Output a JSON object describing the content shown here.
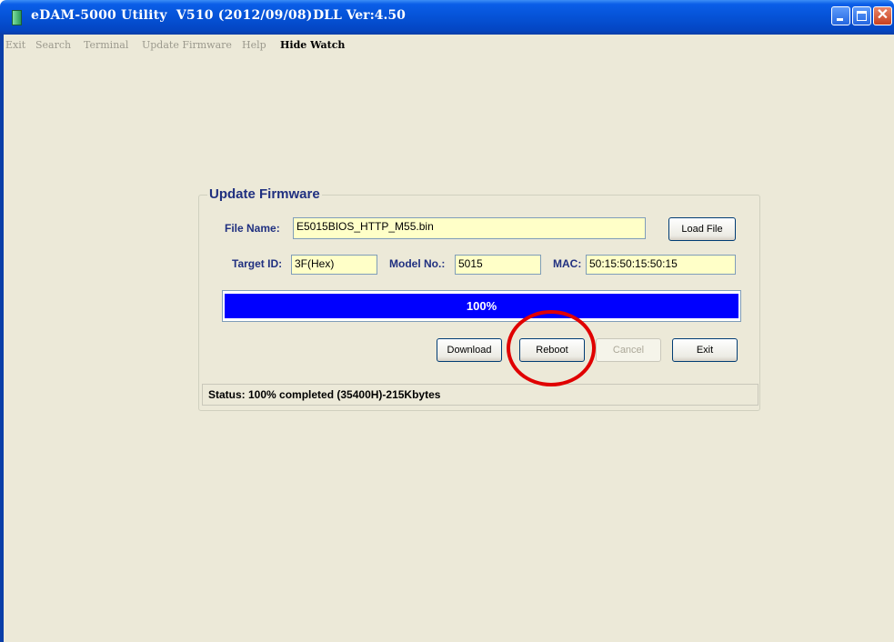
{
  "window": {
    "title": "eDAM-5000 Utility  V510 (2012/09/08)",
    "dll_version": "DLL Ver:4.50"
  },
  "menu": {
    "items": [
      {
        "label": "Exit",
        "enabled": false
      },
      {
        "label": "Search",
        "enabled": false
      },
      {
        "label": "Terminal",
        "enabled": false
      },
      {
        "label": "Update Firmware",
        "enabled": false
      },
      {
        "label": "Help",
        "enabled": false
      },
      {
        "label": "Hide Watch",
        "enabled": true
      }
    ]
  },
  "update_firmware": {
    "group_title": "Update Firmware",
    "file_name_label": "File Name:",
    "file_name_value": "E5015BIOS_HTTP_M55.bin",
    "load_file_label": "Load File",
    "target_id_label": "Target ID:",
    "target_id_value": "3F(Hex)",
    "model_no_label": "Model No.:",
    "model_no_value": "5015",
    "mac_label": "MAC:",
    "mac_value": "50:15:50:15:50:15",
    "progress_percent": 100,
    "progress_text": "100%",
    "buttons": {
      "download": "Download",
      "reboot": "Reboot",
      "cancel": "Cancel",
      "exit": "Exit"
    },
    "status_text": "Status: 100% completed (35400H)-215Kbytes"
  },
  "colors": {
    "titlebar": "#0552d6",
    "progress_fill": "#0000ff",
    "field_background": "#ffffc8",
    "label_text": "#203080",
    "highlight": "#e00000"
  }
}
